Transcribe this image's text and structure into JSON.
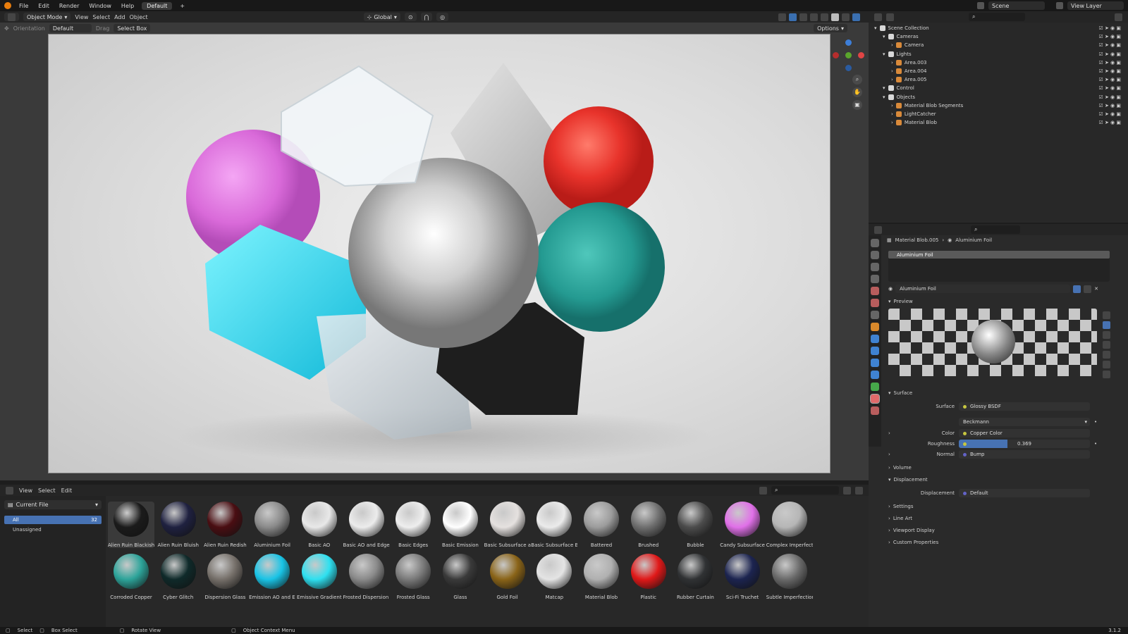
{
  "menu": [
    "File",
    "Edit",
    "Render",
    "Window",
    "Help"
  ],
  "workspace": "Default",
  "scene": "Scene",
  "view_layer": "View Layer",
  "viewport": {
    "mode": "Object Mode",
    "menus": [
      "View",
      "Select",
      "Add",
      "Object"
    ],
    "transform_space": "Global",
    "orientation_label": "Orientation",
    "orientation_value": "Default",
    "drag_label": "Drag",
    "drag_value": "Select Box",
    "options": "Options"
  },
  "outliner": {
    "items": [
      {
        "label": "Scene Collection",
        "depth": 0,
        "icon": "collection-icon"
      },
      {
        "label": "Cameras",
        "depth": 1,
        "icon": "collection-icon"
      },
      {
        "label": "Camera",
        "depth": 2,
        "icon": "camera-icon"
      },
      {
        "label": "Lights",
        "depth": 1,
        "icon": "collection-icon"
      },
      {
        "label": "Area.003",
        "depth": 2,
        "icon": "light-icon"
      },
      {
        "label": "Area.004",
        "depth": 2,
        "icon": "light-icon"
      },
      {
        "label": "Area.005",
        "depth": 2,
        "icon": "light-icon"
      },
      {
        "label": "Control",
        "depth": 1,
        "icon": "collection-icon"
      },
      {
        "label": "Objects",
        "depth": 1,
        "icon": "collection-icon"
      },
      {
        "label": "Material Blob Segments",
        "depth": 2,
        "icon": "mesh-icon"
      },
      {
        "label": "LightCatcher",
        "depth": 2,
        "icon": "mesh-icon"
      },
      {
        "label": "Material Blob",
        "depth": 2,
        "icon": "mesh-icon"
      }
    ]
  },
  "properties": {
    "breadcrumb_object": "Material Blob.005",
    "breadcrumb_material": "Aluminium Foil",
    "slot": "Aluminium Foil",
    "material_name": "Aluminium Foil",
    "preview_label": "Preview",
    "surface_section": "Surface",
    "surface_label": "Surface",
    "surface_value": "Glossy BSDF",
    "distribution": "Beckmann",
    "color_label": "Color",
    "color_value": "Copper Color",
    "roughness_label": "Roughness",
    "roughness_value": "0.369",
    "roughness": 0.369,
    "normal_label": "Normal",
    "normal_value": "Bump",
    "volume": "Volume",
    "displacement_section": "Displacement",
    "displacement_label": "Displacement",
    "displacement_value": "Default",
    "settings": "Settings",
    "line_art": "Line Art",
    "viewport_display": "Viewport Display",
    "custom_properties": "Custom Properties"
  },
  "asset_browser": {
    "menus": [
      "View",
      "Select",
      "Edit"
    ],
    "library": "Current File",
    "categories": [
      {
        "label": "All",
        "count": "32"
      },
      {
        "label": "Unassigned",
        "count": ""
      }
    ],
    "materials": [
      {
        "name": "Alien Ruin Blackish",
        "color": "#1b1b1b"
      },
      {
        "name": "Alien Ruin Bluish",
        "color": "#1f2140"
      },
      {
        "name": "Alien Ruin Redish",
        "color": "#4a0e12"
      },
      {
        "name": "Aluminium Foil",
        "color": "#8a8a8a"
      },
      {
        "name": "Basic AO",
        "color": "#e8e8e8"
      },
      {
        "name": "Basic AO and Edge...",
        "color": "#ececec"
      },
      {
        "name": "Basic Edges",
        "color": "#eeeeee"
      },
      {
        "name": "Basic Emission",
        "color": "#ffffff"
      },
      {
        "name": "Basic Subsurface a...",
        "color": "#e5e1df"
      },
      {
        "name": "Basic Subsurface B...",
        "color": "#ebebeb"
      },
      {
        "name": "Battered",
        "color": "#9c9c9c"
      },
      {
        "name": "Brushed",
        "color": "#6f6f6f"
      },
      {
        "name": "Bubble",
        "color": "#4c4c4c"
      },
      {
        "name": "Candy Subsurface",
        "color": "#e070e8"
      },
      {
        "name": "Complex Imperfect...",
        "color": "#b6b6b6"
      },
      {
        "name": "Corroded Copper",
        "color": "#2da49a"
      },
      {
        "name": "Cyber Glitch",
        "color": "#0f2a2a"
      },
      {
        "name": "Dispersion Glass",
        "color": "#76706a"
      },
      {
        "name": "Emission AO and E...",
        "color": "#19c4e6"
      },
      {
        "name": "Emissive Gradient",
        "color": "#2ee0f0"
      },
      {
        "name": "Frosted Dispersion ...",
        "color": "#8a8a8a"
      },
      {
        "name": "Frosted Glass",
        "color": "#7a7a7a"
      },
      {
        "name": "Glass",
        "color": "#3a3a3a"
      },
      {
        "name": "Gold Foil",
        "color": "#8a6418"
      },
      {
        "name": "Matcap",
        "color": "#e4e4e4"
      },
      {
        "name": "Material Blob",
        "color": "#b0b0b0"
      },
      {
        "name": "Plastic",
        "color": "#e01818"
      },
      {
        "name": "Rubber Curtain",
        "color": "#303234"
      },
      {
        "name": "Sci-Fi Truchet",
        "color": "#1c2450"
      },
      {
        "name": "Subtle Imperfection",
        "color": "#6a6a6a"
      }
    ]
  },
  "status": {
    "select": "Select",
    "box_select": "Box Select",
    "rotate": "Rotate View",
    "context": "Object Context Menu",
    "version": "3.1.2"
  }
}
